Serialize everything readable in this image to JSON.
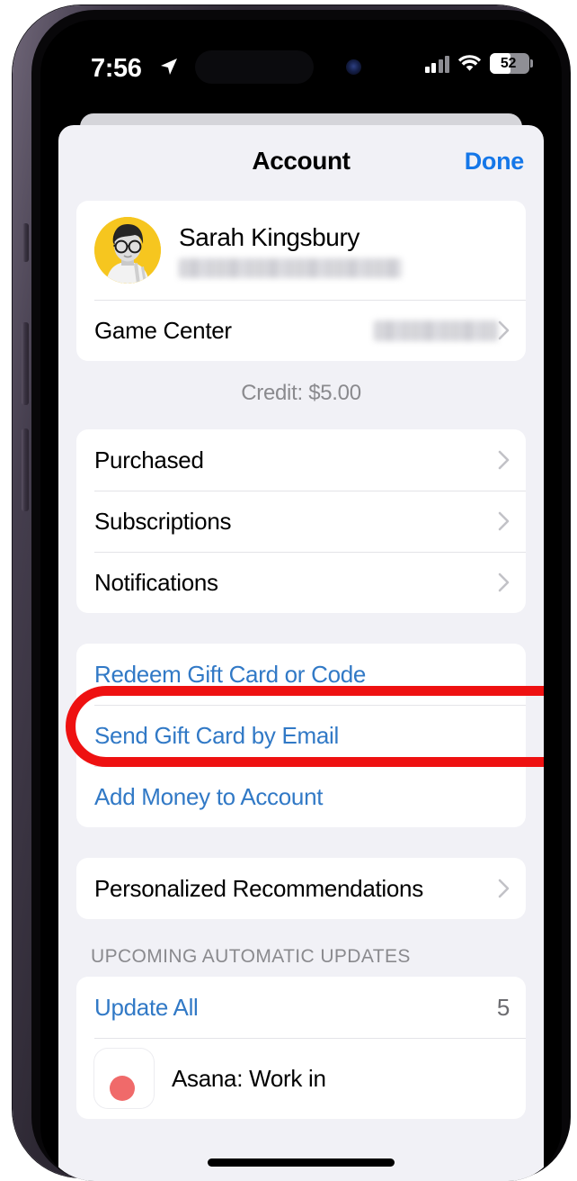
{
  "status_bar": {
    "time": "7:56",
    "location_icon": "location-arrow-icon",
    "cellular_icon": "cellular-signal-icon",
    "wifi_icon": "wifi-icon",
    "battery_level": "52",
    "battery_percent": 52
  },
  "header": {
    "title": "Account",
    "done_label": "Done"
  },
  "profile": {
    "name": "Sarah Kingsbury",
    "email_redacted": true,
    "avatar_name": "user-avatar",
    "avatar_background": "#f6c61f"
  },
  "game_center": {
    "label": "Game Center",
    "value_redacted": true
  },
  "credit_note": "Credit: $5.00",
  "account_links": [
    {
      "label": "Purchased",
      "chevron": true
    },
    {
      "label": "Subscriptions",
      "chevron": true
    },
    {
      "label": "Notifications",
      "chevron": true
    }
  ],
  "gift_card_links": [
    {
      "label": "Redeem Gift Card or Code",
      "highlighted": true
    },
    {
      "label": "Send Gift Card by Email",
      "highlighted": false
    },
    {
      "label": "Add Money to Account",
      "highlighted": false
    }
  ],
  "recommendations": {
    "label": "Personalized Recommendations",
    "chevron": true
  },
  "updates_section": {
    "header": "UPCOMING AUTOMATIC UPDATES",
    "update_all_label": "Update All",
    "update_count": "5",
    "apps": [
      {
        "name": "Asana: Work in",
        "icon": "asana-app-icon"
      }
    ]
  },
  "annotation": {
    "shape": "oval",
    "color": "#ee1111",
    "target": "Redeem Gift Card or Code"
  },
  "colors": {
    "link_blue": "#3179c6",
    "done_blue": "#1577e8",
    "sheet_background": "#f1f1f6",
    "card_white": "#ffffff",
    "secondary_text": "#8a8a8e"
  }
}
